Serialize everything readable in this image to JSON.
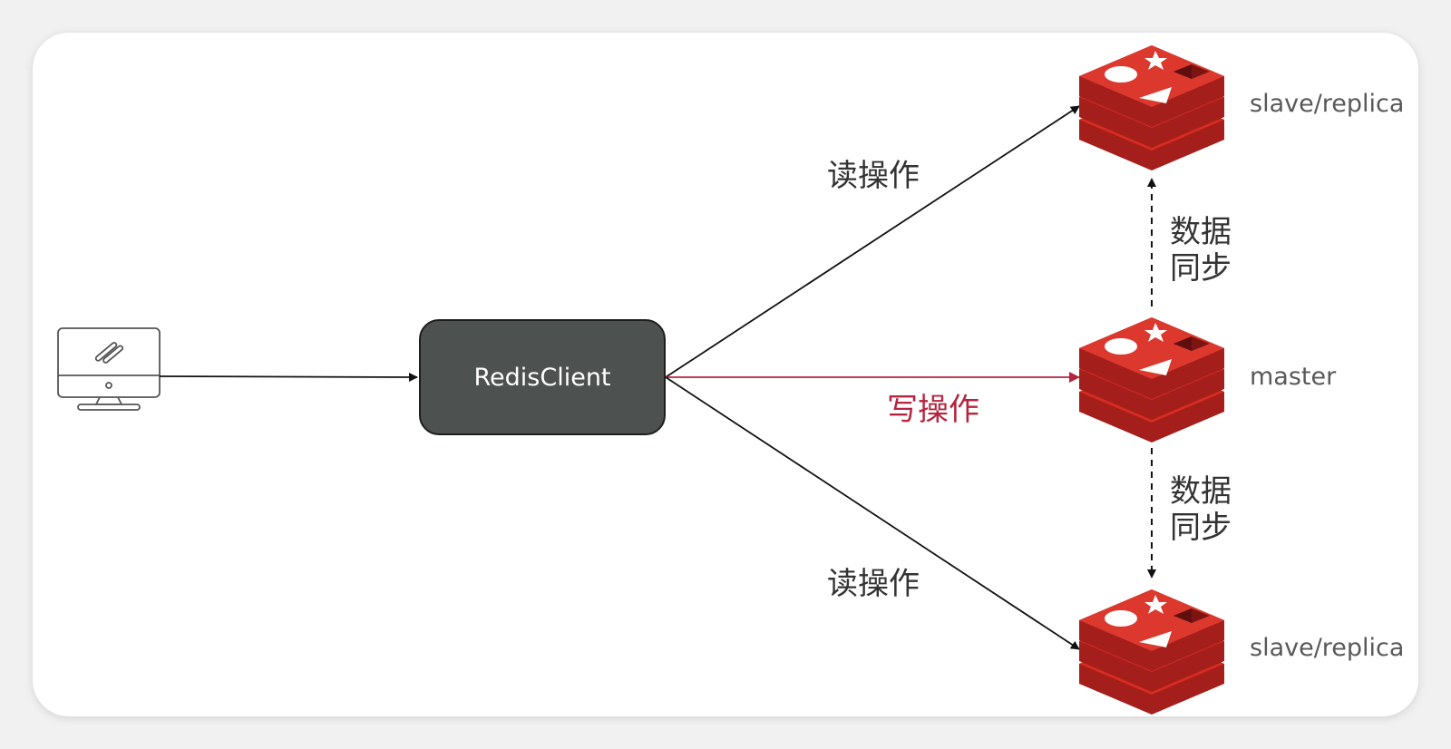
{
  "client": {
    "label": "RedisClient"
  },
  "edges": {
    "read_top": "读操作",
    "write": "写操作",
    "read_bottom": "读操作"
  },
  "sync": {
    "top_line1": "数据",
    "top_line2": "同步",
    "bottom_line1": "数据",
    "bottom_line2": "同步"
  },
  "nodes": {
    "top": "slave/replica",
    "middle": "master",
    "bottom": "slave/replica"
  },
  "colors": {
    "write_edge": "#b5253f",
    "redis_red": "#d82c20",
    "client_box": "#4d5150"
  },
  "icons": [
    "computer-icon",
    "redis-logo-icon"
  ]
}
